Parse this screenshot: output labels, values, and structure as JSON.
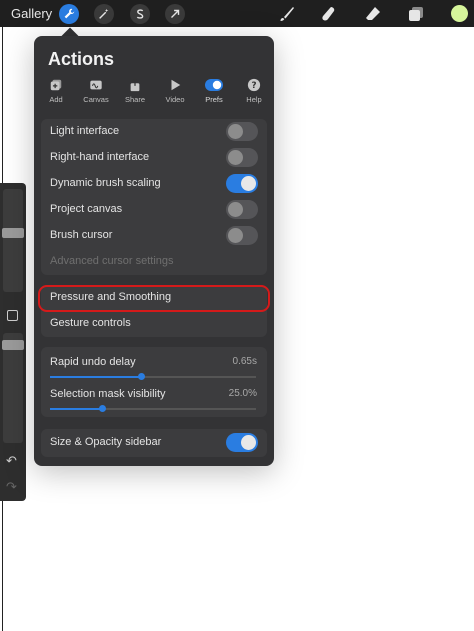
{
  "toolbar": {
    "gallery_label": "Gallery",
    "left_icons": [
      "wrench-icon",
      "magic-wand-icon",
      "selection-s-icon",
      "transform-arrow-icon"
    ],
    "right_tools": [
      "brush-icon",
      "smudge-icon",
      "eraser-icon",
      "layers-icon"
    ],
    "color_swatch": "#d6f59b",
    "active_color": "#2a7de1"
  },
  "actions": {
    "title": "Actions",
    "tabs": [
      {
        "label": "Add",
        "icon": "add-icon"
      },
      {
        "label": "Canvas",
        "icon": "canvas-icon"
      },
      {
        "label": "Share",
        "icon": "share-icon"
      },
      {
        "label": "Video",
        "icon": "video-play-icon"
      },
      {
        "label": "Prefs",
        "icon": "toggle-icon",
        "active": true
      },
      {
        "label": "Help",
        "icon": "help-icon"
      }
    ],
    "toggles": [
      {
        "label": "Light interface",
        "on": false
      },
      {
        "label": "Right-hand interface",
        "on": false
      },
      {
        "label": "Dynamic brush scaling",
        "on": true
      },
      {
        "label": "Project canvas",
        "on": false
      },
      {
        "label": "Brush cursor",
        "on": false
      }
    ],
    "advanced_cursor": "Advanced cursor settings",
    "pressure": "Pressure and Smoothing",
    "gesture": "Gesture controls",
    "sliders": [
      {
        "label": "Rapid undo delay",
        "value": "0.65s",
        "fraction": 0.44
      },
      {
        "label": "Selection mask visibility",
        "value": "25.0%",
        "fraction": 0.25
      }
    ],
    "sidebar_toggle": {
      "label": "Size & Opacity sidebar",
      "on": true
    }
  }
}
